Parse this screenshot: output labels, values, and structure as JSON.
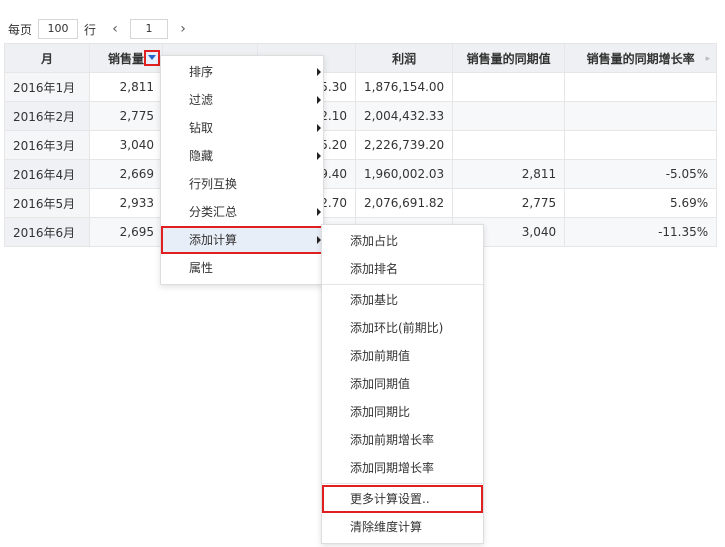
{
  "pager": {
    "per_page_label": "每页",
    "per_page_value": "100",
    "row_label": "行",
    "prev": "‹",
    "page": "1",
    "next": "›"
  },
  "table": {
    "headers": [
      "月",
      "销售量",
      "",
      "",
      "利润",
      "销售量的同期值",
      "销售量的同期增长率"
    ],
    "rows": [
      [
        "2016年1月",
        "2,811",
        "",
        "5.30",
        "1,876,154.00",
        "",
        ""
      ],
      [
        "2016年2月",
        "2,775",
        "",
        "2.10",
        "2,004,432.33",
        "",
        ""
      ],
      [
        "2016年3月",
        "3,040",
        "",
        "5.20",
        "2,226,739.20",
        "",
        ""
      ],
      [
        "2016年4月",
        "2,669",
        "",
        "9.40",
        "1,960,002.03",
        "2,811",
        "-5.05%"
      ],
      [
        "2016年5月",
        "2,933",
        "",
        "2.70",
        "2,076,691.82",
        "2,775",
        "5.69%"
      ],
      [
        "2016年6月",
        "2,695",
        "",
        "",
        "",
        "3,040",
        "-11.35%"
      ]
    ]
  },
  "context_menu": {
    "items": [
      "排序",
      "过滤",
      "钻取",
      "隐藏",
      "行列互换",
      "分类汇总",
      "添加计算",
      "属性"
    ]
  },
  "submenu": {
    "group1": [
      "添加占比",
      "添加排名"
    ],
    "group2": [
      "添加基比",
      "添加环比(前期比)",
      "添加前期值",
      "添加同期值",
      "添加同期比",
      "添加前期增长率",
      "添加同期增长率"
    ],
    "more": "更多计算设置..",
    "clear": "清除维度计算"
  },
  "colors": {
    "highlight_border": "#e02020",
    "header_bg": "#eef0f3",
    "dropdown_triangle": "#2266cc"
  }
}
